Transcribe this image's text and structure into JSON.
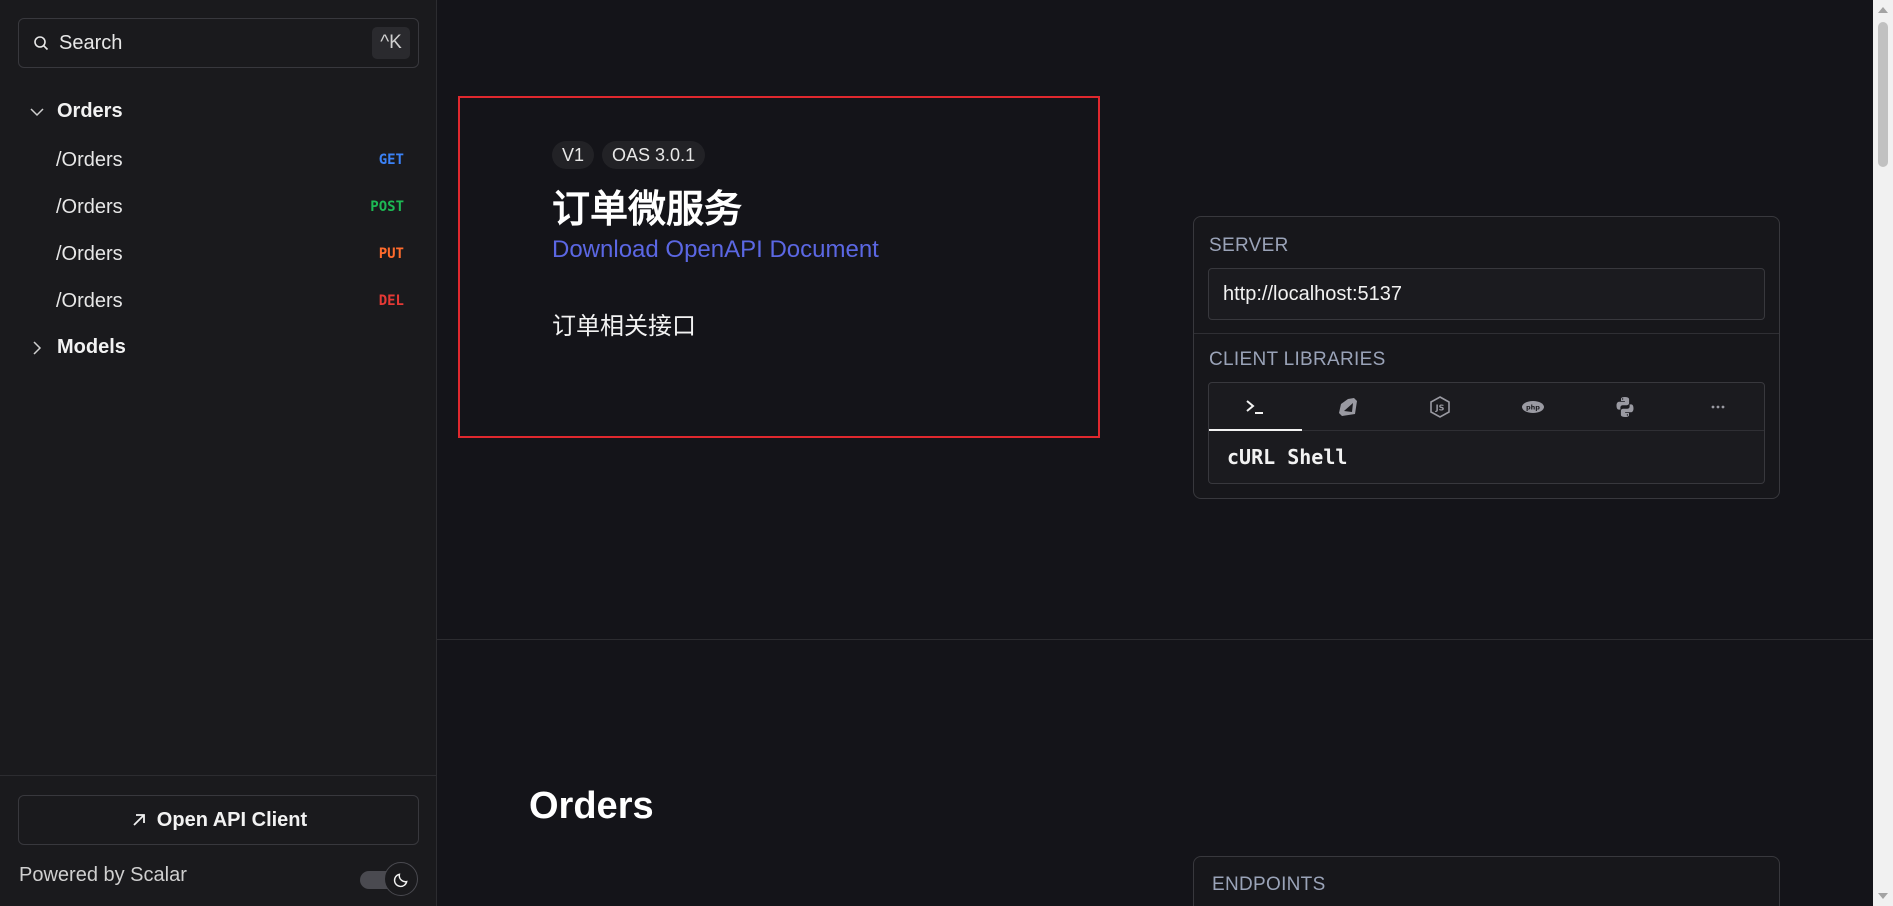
{
  "sidebar": {
    "search": {
      "placeholder": "Search",
      "shortcut": "^K"
    },
    "groups": [
      {
        "label": "Orders",
        "expanded": true
      },
      {
        "label": "Models",
        "expanded": false
      }
    ],
    "items": [
      {
        "path": "/Orders",
        "method": "GET",
        "method_color": "#3b82f6"
      },
      {
        "path": "/Orders",
        "method": "POST",
        "method_color": "#1db954"
      },
      {
        "path": "/Orders",
        "method": "PUT",
        "method_color": "#ff6b2c"
      },
      {
        "path": "/Orders",
        "method": "DEL",
        "method_color": "#e53935"
      }
    ],
    "footer": {
      "open_client_label": "Open API Client",
      "powered_by": "Powered by Scalar"
    }
  },
  "intro": {
    "version_badge": "V1",
    "oas_badge": "OAS 3.0.1",
    "title": "订单微服务",
    "download_link": "Download OpenAPI Document",
    "description": "订单相关接口"
  },
  "server_card": {
    "server_label": "SERVER",
    "server_url": "http://localhost:5137",
    "libraries_label": "CLIENT LIBRARIES",
    "library_tabs": [
      {
        "icon": "terminal-icon"
      },
      {
        "icon": "ruby-icon"
      },
      {
        "icon": "nodejs-icon"
      },
      {
        "icon": "php-icon"
      },
      {
        "icon": "python-icon"
      },
      {
        "icon": "more-icon"
      }
    ],
    "selected_library": "cURL Shell"
  },
  "sections": {
    "orders_title": "Orders",
    "endpoints_label": "ENDPOINTS"
  },
  "colors": {
    "accent_link": "#5b67e3",
    "highlight_border": "#e0282e"
  }
}
